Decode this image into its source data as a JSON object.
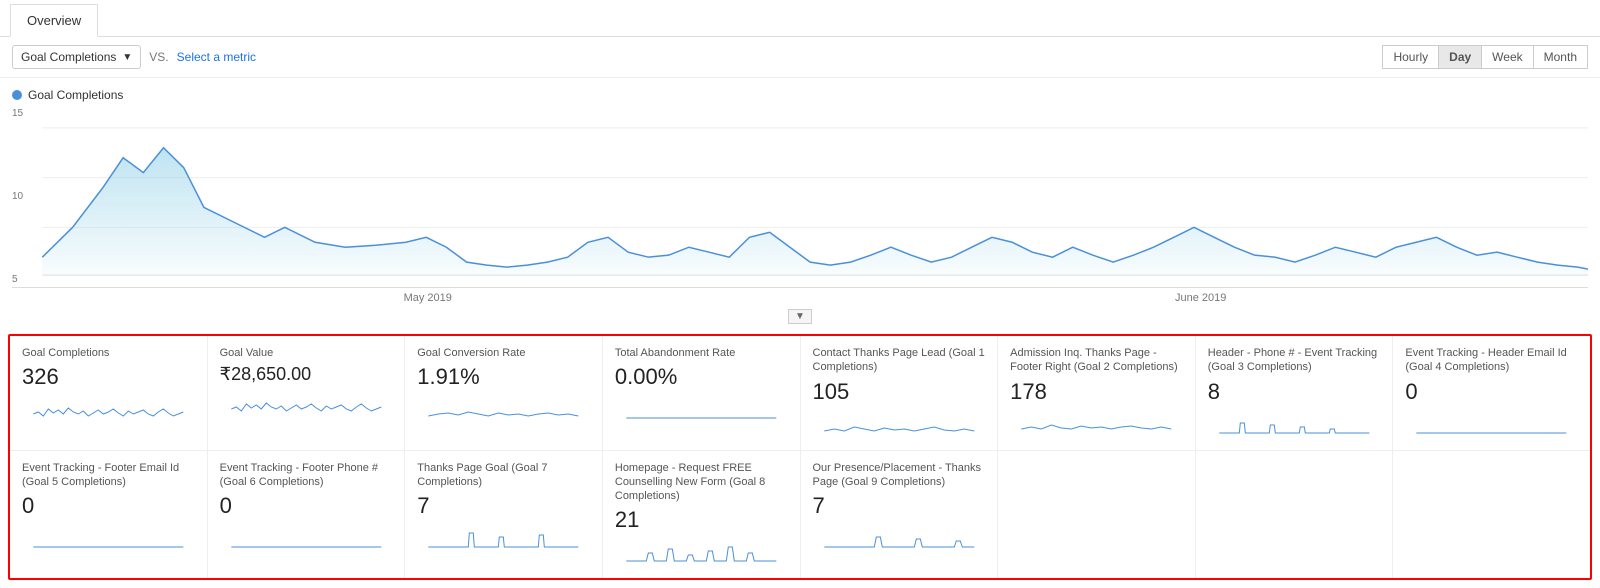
{
  "tabs": [
    {
      "label": "Overview",
      "active": true
    }
  ],
  "toolbar": {
    "metric_btn_label": "Goal Completions",
    "vs_label": "VS.",
    "select_metric_label": "Select a metric",
    "time_buttons": [
      {
        "label": "Hourly",
        "active": false
      },
      {
        "label": "Day",
        "active": true
      },
      {
        "label": "Week",
        "active": false
      },
      {
        "label": "Month",
        "active": false
      }
    ]
  },
  "chart": {
    "legend_label": "Goal Completions",
    "y_labels": [
      "15",
      "10",
      "5"
    ],
    "x_labels": [
      "May 2019",
      "June 2019"
    ]
  },
  "metrics_rows": [
    {
      "cells": [
        {
          "label": "Goal Completions",
          "value": "326",
          "has_sparkline": true
        },
        {
          "label": "Goal Value",
          "value": "₹28,650.00",
          "has_sparkline": true
        },
        {
          "label": "Goal Conversion Rate",
          "value": "1.91%",
          "has_sparkline": true
        },
        {
          "label": "Total Abandonment Rate",
          "value": "0.00%",
          "has_sparkline": false
        },
        {
          "label": "Contact Thanks Page Lead (Goal 1 Completions)",
          "value": "105",
          "has_sparkline": true
        },
        {
          "label": "Admission Inq. Thanks Page - Footer Right (Goal 2 Completions)",
          "value": "178",
          "has_sparkline": true
        },
        {
          "label": "Header - Phone # - Event Tracking (Goal 3 Completions)",
          "value": "8",
          "has_sparkline": true
        },
        {
          "label": "Event Tracking - Header Email Id (Goal 4 Completions)",
          "value": "0",
          "has_sparkline": false
        }
      ]
    },
    {
      "cells": [
        {
          "label": "Event Tracking - Footer Email Id (Goal 5 Completions)",
          "value": "0",
          "has_sparkline": false
        },
        {
          "label": "Event Tracking - Footer Phone # (Goal 6 Completions)",
          "value": "0",
          "has_sparkline": false
        },
        {
          "label": "Thanks Page Goal (Goal 7 Completions)",
          "value": "7",
          "has_sparkline": true
        },
        {
          "label": "Homepage - Request FREE Counselling New Form (Goal 8 Completions)",
          "value": "21",
          "has_sparkline": true
        },
        {
          "label": "Our Presence/Placement - Thanks Page (Goal 9 Completions)",
          "value": "7",
          "has_sparkline": true
        },
        {
          "label": "",
          "value": "",
          "has_sparkline": false
        },
        {
          "label": "",
          "value": "",
          "has_sparkline": false
        },
        {
          "label": "",
          "value": "",
          "has_sparkline": false
        }
      ]
    }
  ]
}
